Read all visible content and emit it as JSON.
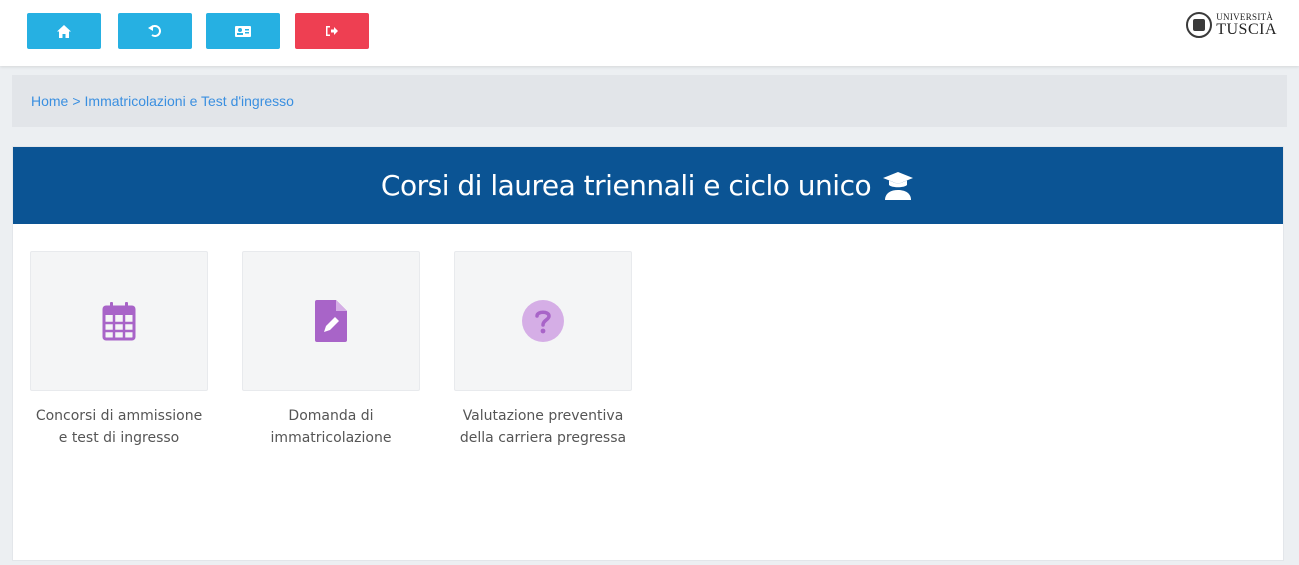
{
  "toolbar": {
    "buttons": [
      {
        "name": "home",
        "icon": "home-icon",
        "color": "#26b0e2"
      },
      {
        "name": "back",
        "icon": "undo-icon",
        "color": "#26b0e2"
      },
      {
        "name": "profile",
        "icon": "id-card-icon",
        "color": "#26b0e2"
      },
      {
        "name": "logout",
        "icon": "sign-out-icon",
        "color": "#ee3f52"
      }
    ]
  },
  "logo": {
    "line1": "UNIVERSITÀ",
    "line2": "TUSCIA"
  },
  "breadcrumb": {
    "home": "Home",
    "separator": ">",
    "current": "Immatricolazioni e Test d'ingresso"
  },
  "panel": {
    "title": "Corsi di laurea triennali e ciclo unico",
    "title_icon": "graduate-icon",
    "header_color": "#0b5494"
  },
  "tiles": [
    {
      "label": "Concorsi di ammissione e test di ingresso",
      "icon": "calendar-icon"
    },
    {
      "label": "Domanda di immatricolazione",
      "icon": "file-signature-icon"
    },
    {
      "label": "Valutazione preventiva della carriera pregressa",
      "icon": "question-circle-icon"
    }
  ],
  "colors": {
    "accent_purple": "#a864c8",
    "light_purple": "#d5aee6",
    "link": "#3a8fe0"
  }
}
